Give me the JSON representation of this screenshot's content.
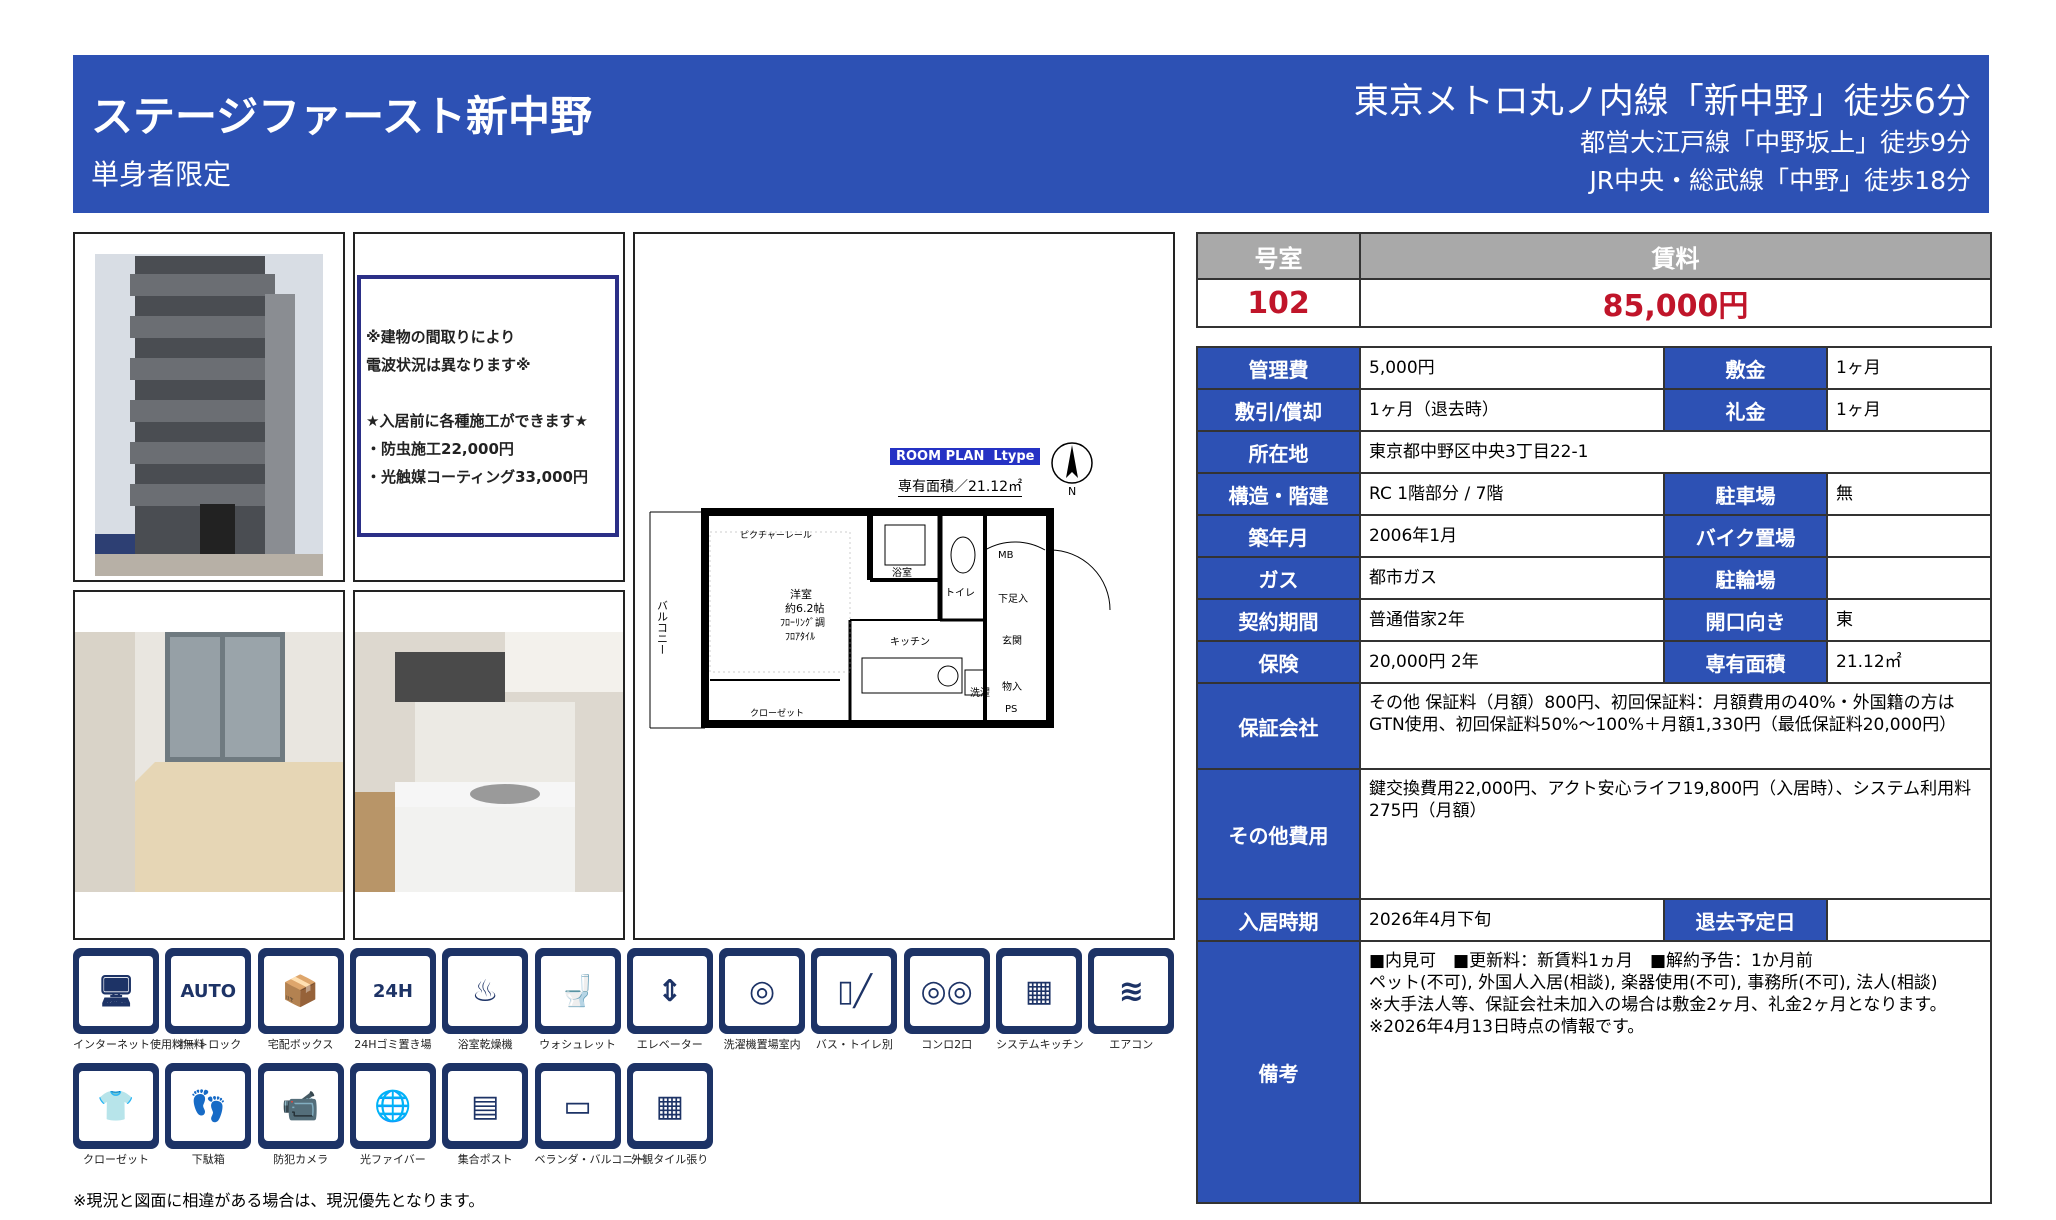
{
  "header": {
    "title": "ステージファースト新中野",
    "subtitle": "単身者限定",
    "access": [
      "東京メトロ丸ノ内線「新中野」徒歩6分",
      "都営大江戸線「中野坂上」徒歩9分",
      "JR中央・総武線「中野」徒歩18分"
    ]
  },
  "notice_lines": [
    "※建物の間取りにより",
    "電波状況は異なります※",
    "",
    "★入居前に各種施工ができます★",
    "・防虫施工22,000円",
    "・光触媒コーティング33,000円"
  ],
  "floorplan": {
    "badge": "ROOM PLAN  Ltype",
    "area": "専有面積／21.12㎡",
    "labels": [
      "ピクチャーレール",
      "洋室",
      "約6.2帖",
      "ﾌﾛｰﾘﾝｸﾞ調",
      "ﾌﾛｱﾀｲﾙ",
      "浴室",
      "トイレ",
      "MB",
      "下足入",
      "玄関",
      "キッチン",
      "洗濯",
      "物入",
      "PS",
      "クローゼット",
      "バルコニー",
      "N"
    ]
  },
  "price": {
    "room_header": "号室",
    "rent_header": "賃料",
    "room": "102",
    "rent": "85,000円"
  },
  "details": {
    "kanrihi_label": "管理費",
    "kanrihi": "5,000円",
    "shikikin_label": "敷金",
    "shikikin": "1ヶ月",
    "shikibiki_label": "敷引/償却",
    "shikibiki": "1ヶ月（退去時）",
    "reikin_label": "礼金",
    "reikin": "1ヶ月",
    "address_label": "所在地",
    "address": "東京都中野区中央3丁目22-1",
    "structure_label": "構造・階建",
    "structure": "RC 1階部分 / 7階",
    "parking_label": "駐車場",
    "parking": "無",
    "built_label": "築年月",
    "built": "2006年1月",
    "bike_label": "バイク置場",
    "bike": "",
    "gas_label": "ガス",
    "gas": "都市ガス",
    "bicycle_label": "駐輪場",
    "bicycle": "",
    "contract_label": "契約期間",
    "contract": "普通借家2年",
    "direction_label": "開口向き",
    "direction": "東",
    "insurance_label": "保険",
    "insurance": "20,000円 2年",
    "area_label": "専有面積",
    "area": "21.12㎡",
    "guarantor_label": "保証会社",
    "guarantor": "その他 保証料（月額）800円、初回保証料：月額費用の40%・外国籍の方はGTN使用、初回保証料50%〜100%＋月額1,330円（最低保証料20,000円）",
    "other_label": "その他費用",
    "other": "鍵交換費用22,000円、アクト安心ライフ19,800円（入居時）、システム利用料275円（月額）",
    "movein_label": "入居時期",
    "movein": "2026年4月下旬",
    "moveout_label": "退去予定日",
    "moveout": "",
    "remarks_label": "備考",
    "remarks": [
      "■内見可　■更新料：新賃料1ヵ月　■解約予告：1か月前",
      "ペット(不可), 外国人入居(相談), 楽器使用(不可), 事務所(不可), 法人(相談)",
      "※大手法人等、保証会社未加入の場合は敷金2ヶ月、礼金2ヶ月となります。",
      "※2026年4月13日時点の情報です。"
    ]
  },
  "amenities": [
    {
      "label": "インターネット使用料無料",
      "icon": "internet-icon"
    },
    {
      "label": "オートロック",
      "icon": "autolock-icon"
    },
    {
      "label": "宅配ボックス",
      "icon": "delivery-box-icon"
    },
    {
      "label": "24Hゴミ置き場",
      "icon": "garbage-24h-icon"
    },
    {
      "label": "浴室乾燥機",
      "icon": "bath-dryer-icon"
    },
    {
      "label": "ウォシュレット",
      "icon": "washlet-icon"
    },
    {
      "label": "エレベーター",
      "icon": "elevator-icon"
    },
    {
      "label": "洗濯機置場室内",
      "icon": "washing-machine-icon"
    },
    {
      "label": "バス・トイレ別",
      "icon": "bath-toilet-separate-icon"
    },
    {
      "label": "コンロ2口",
      "icon": "stove-icon"
    },
    {
      "label": "システムキッチン",
      "icon": "system-kitchen-icon"
    },
    {
      "label": "エアコン",
      "icon": "air-conditioner-icon"
    },
    {
      "label": "クローゼット",
      "icon": "closet-icon"
    },
    {
      "label": "下駄箱",
      "icon": "shoe-box-icon"
    },
    {
      "label": "防犯カメラ",
      "icon": "security-camera-icon"
    },
    {
      "label": "光ファイバー",
      "icon": "optical-fiber-icon"
    },
    {
      "label": "集合ポスト",
      "icon": "mailbox-icon"
    },
    {
      "label": "ベランダ・バルコニー",
      "icon": "balcony-icon"
    },
    {
      "label": "外観タイル張り",
      "icon": "tile-exterior-icon"
    }
  ],
  "footnote": "※現況と図面に相違がある場合は、現況優先となります。"
}
